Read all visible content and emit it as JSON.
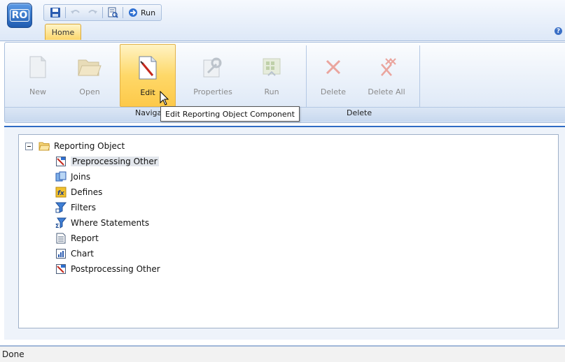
{
  "app": {
    "logo_text": "RO"
  },
  "qat": {
    "run_label": "Run"
  },
  "tabs": {
    "home": "Home"
  },
  "ribbon": {
    "buttons": [
      {
        "label": "New",
        "enabled": false
      },
      {
        "label": "Open",
        "enabled": false
      },
      {
        "label": "Edit",
        "enabled": true
      },
      {
        "label": "Properties",
        "enabled": false
      },
      {
        "label": "Run",
        "enabled": false
      },
      {
        "label": "Delete",
        "enabled": false
      },
      {
        "label": "Delete All",
        "enabled": false
      }
    ],
    "groups": {
      "navigation": "Naviga",
      "delete": "Delete"
    }
  },
  "tooltip": {
    "text": "Edit Reporting Object Component"
  },
  "tree": {
    "root": "Reporting Object",
    "items": [
      {
        "label": "Preprocessing Other",
        "icon": "preprocessing-icon",
        "selected": true
      },
      {
        "label": "Joins",
        "icon": "joins-icon",
        "selected": false
      },
      {
        "label": "Defines",
        "icon": "defines-icon",
        "selected": false
      },
      {
        "label": "Filters",
        "icon": "filters-icon",
        "selected": false
      },
      {
        "label": "Where Statements",
        "icon": "where-statements-icon",
        "selected": false
      },
      {
        "label": "Report",
        "icon": "report-icon",
        "selected": false
      },
      {
        "label": "Chart",
        "icon": "chart-icon",
        "selected": false
      },
      {
        "label": "Postprocessing Other",
        "icon": "postprocessing-icon",
        "selected": false
      }
    ]
  },
  "status": {
    "text": "Done"
  },
  "colors": {
    "accent": "#2f6bc4",
    "highlight": "#fed868"
  }
}
